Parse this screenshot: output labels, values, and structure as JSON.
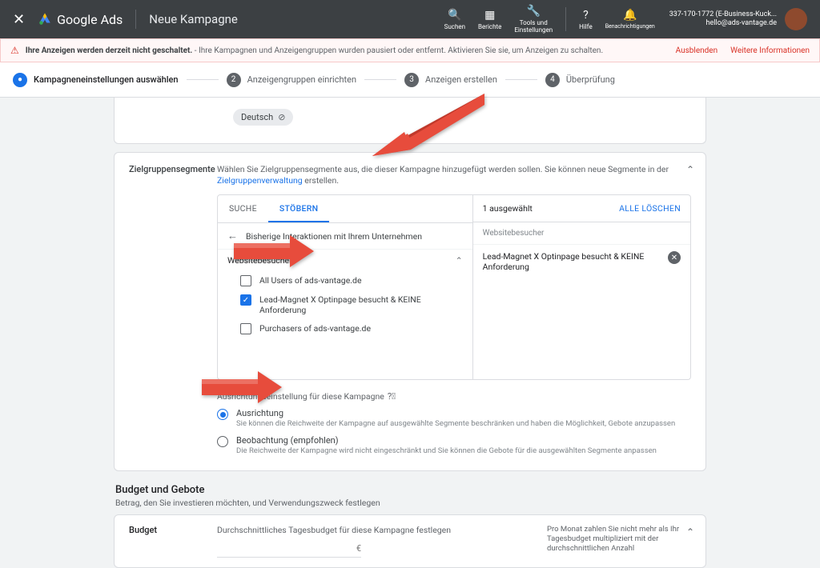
{
  "topbar": {
    "product": "Google Ads",
    "pageTitle": "Neue Kampagne",
    "tools": {
      "search": "Suchen",
      "reports": "Berichte",
      "tools": "Tools und\nEinstellungen",
      "help": "Hilfe"
    },
    "notif": "Benachrichtigungen",
    "acct_id": "337-170-1772 (E-Business-Kuck...",
    "acct_mail": "hello@ads-vantage.de"
  },
  "alert": {
    "strong": "Ihre Anzeigen werden derzeit nicht geschaltet.",
    "rest": " - Ihre Kampagnen und Anzeigengruppen wurden pausiert oder entfernt. Aktivieren Sie sie, um Anzeigen zu schalten.",
    "hide": "Ausblenden",
    "more": "Weitere Informationen"
  },
  "steps": {
    "s1": "Kampagneneinstellungen auswählen",
    "s2": "Anzeigengruppen einrichten",
    "s3": "Anzeigen erstellen",
    "s4": "Überprüfung"
  },
  "lang": {
    "chip": "Deutsch"
  },
  "seg": {
    "title": "Zielgruppensegmente",
    "desc1": "Wählen Sie Zielgruppensegmente aus, die dieser Kampagne hinzugefügt werden sollen. Sie können neue Segmente in der ",
    "descLink": "Zielgruppenverwaltung",
    "desc2": " erstellen.",
    "tabSearch": "SUCHE",
    "tabBrowse": "STÖBERN",
    "crumb": "Bisherige Interaktionen mit Ihrem Unternehmen",
    "group": "Websitebesucher",
    "opt1": "All Users of ads-vantage.de",
    "opt2": "Lead-Magnet X Optinpage besucht & KEINE Anforderung",
    "opt3": "Purchasers of ads-vantage.de",
    "selCount": "1 ausgewählt",
    "clear": "ALLE LÖSCHEN",
    "selGroup": "Websitebesucher",
    "selItem": "Lead-Magnet X Optinpage besucht & KEINE Anforderung",
    "settingLabel": "Ausrichtungseinstellung für diese Kampagne",
    "r1t": "Ausrichtung",
    "r1d": "Sie können die Reichweite der Kampagne auf ausgewählte Segmente beschränken und haben die Möglichkeit, Gebote anzupassen",
    "r2t": "Beobachtung (empfohlen)",
    "r2d": "Die Reichweite der Kampagne wird nicht eingeschränkt und Sie können die Gebote für die ausgewählten Segmente anpassen"
  },
  "budget": {
    "section": "Budget und Gebote",
    "sectionSub": "Betrag, den Sie investieren möchten, und Verwendungszweck festlegen",
    "title": "Budget",
    "sub": "Durchschnittliches Tagesbudget für diese Kampagne festlegen",
    "cur": "€",
    "hint": "Pro Monat zahlen Sie nicht mehr als Ihr Tagesbudget multipliziert mit der durchschnittlichen Anzahl"
  }
}
